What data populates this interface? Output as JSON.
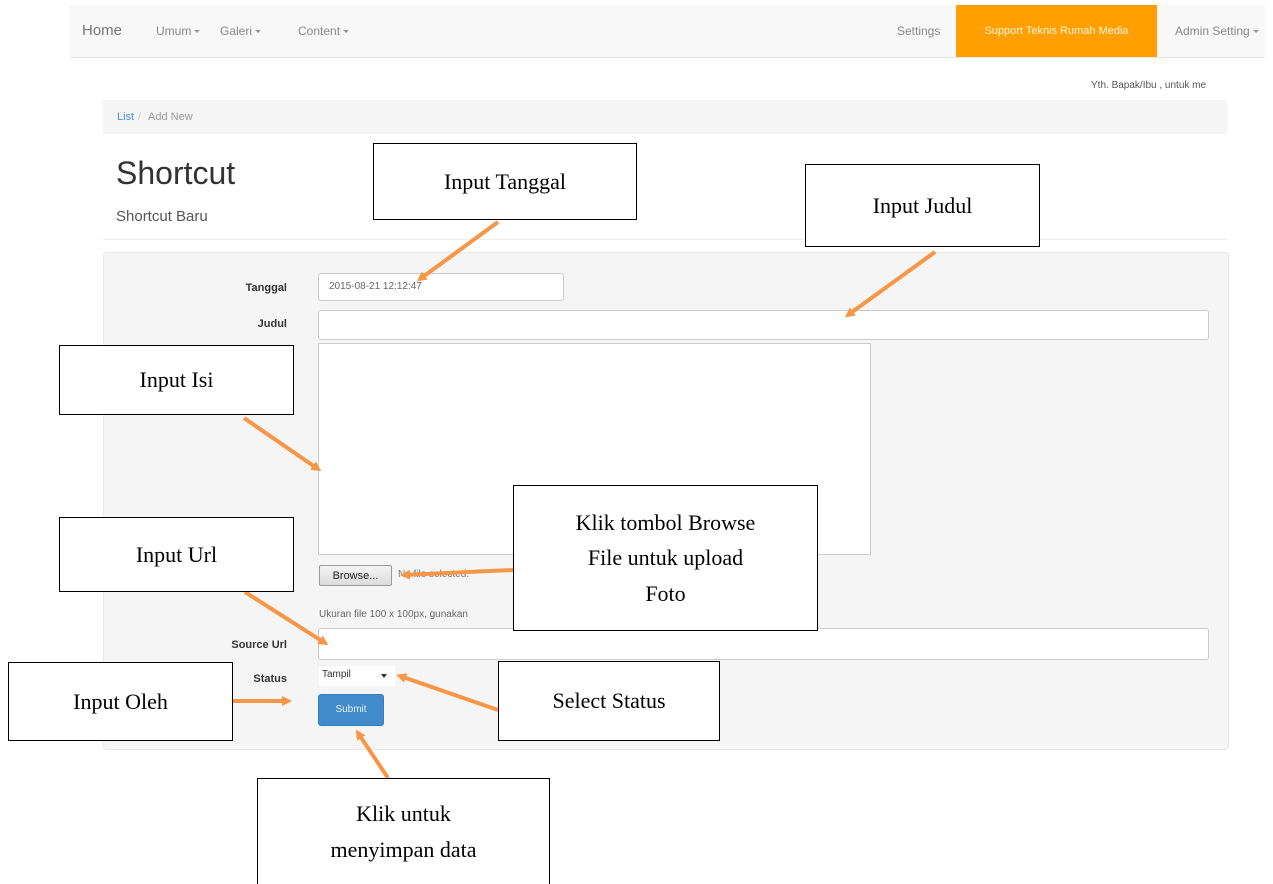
{
  "navbar": {
    "brand": "Home",
    "menus": [
      "Umum",
      "Galeri",
      "Content"
    ],
    "settings": "Settings",
    "support": "Support Teknis Rumah Media",
    "admin": "Admin Setting"
  },
  "greeting": "Yth. Bapak/Ibu , untuk me",
  "breadcrumb": {
    "link": "List",
    "separator": "/",
    "active": "Add New"
  },
  "page": {
    "title": "Shortcut",
    "subtitle": "Shortcut Baru"
  },
  "form": {
    "tanggal": {
      "label": "Tanggal",
      "value": "2015-08-21 12:12:47"
    },
    "judul": {
      "label": "Judul",
      "value": ""
    },
    "isi": {
      "value": ""
    },
    "file": {
      "browse_label": "Browse...",
      "status": "No file selected.",
      "help": "Ukuran file 100 x 100px, gunakan"
    },
    "source_url": {
      "label": "Source Url",
      "value": ""
    },
    "status": {
      "label": "Status",
      "selected": "Tampil"
    },
    "submit_label": "Submit"
  },
  "annotations": {
    "tanggal": "Input Tanggal",
    "judul": "Input Judul",
    "isi": "Input Isi",
    "url": "Input Url",
    "browse": [
      "Klik tombol Browse",
      "File untuk upload",
      "Foto"
    ],
    "oleh": "Input Oleh",
    "status": "Select Status",
    "submit": [
      "Klik untuk",
      "menyimpan data"
    ],
    "arrow_color": "#f79646"
  },
  "colors": {
    "support_bg": "#ff9f00",
    "submit_bg": "#428bca",
    "link": "#4c8fd6"
  }
}
